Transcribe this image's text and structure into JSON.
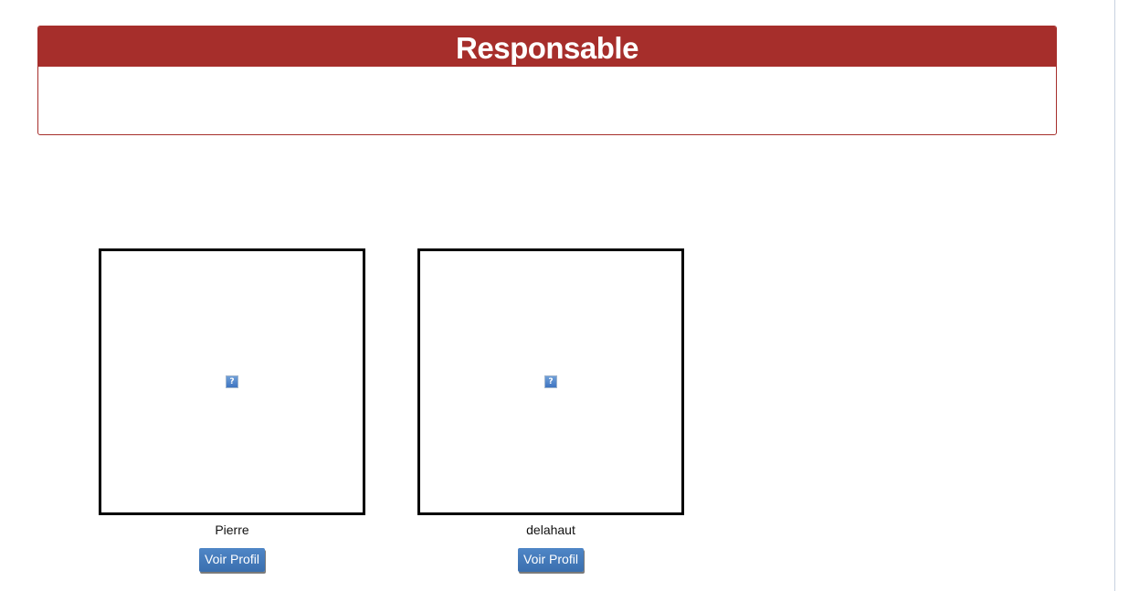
{
  "panel": {
    "title": "Responsable"
  },
  "people": [
    {
      "name": "Pierre",
      "button_label": "Voir Profil",
      "image_placeholder": "?"
    },
    {
      "name": "delahaut",
      "button_label": "Voir Profil",
      "image_placeholder": "?"
    }
  ],
  "icons": {
    "photo": "broken-image-icon"
  },
  "colors": {
    "panel_header": "#a62e2b",
    "button": "#3a6faf"
  }
}
